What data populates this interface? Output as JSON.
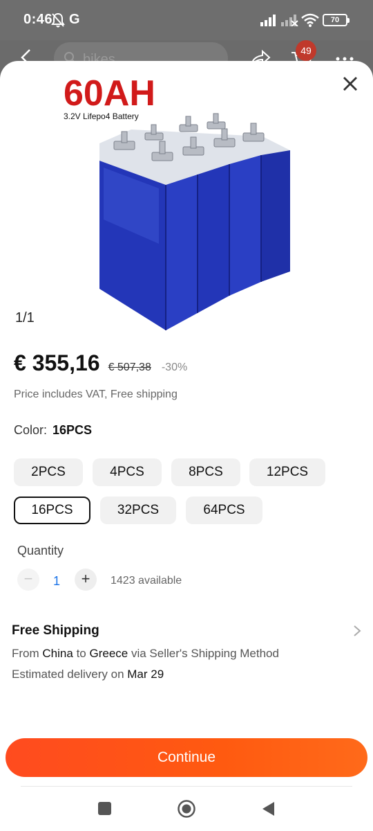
{
  "status_bar": {
    "time": "0:46",
    "carrier_letter": "G",
    "battery": "70"
  },
  "background_header": {
    "search_text": "bikes",
    "cart_badge": "49"
  },
  "product": {
    "image_brand": "60AH",
    "image_subtitle": "3.2V Lifepo4 Battery",
    "image_counter": "1/1",
    "price": "€ 355,16",
    "old_price": "€ 507,38",
    "discount": "-30%",
    "vat_note": "Price includes VAT, Free shipping"
  },
  "color": {
    "label": "Color:",
    "selected": "16PCS",
    "options": [
      "2PCS",
      "4PCS",
      "8PCS",
      "12PCS",
      "16PCS",
      "32PCS",
      "64PCS"
    ]
  },
  "quantity": {
    "label": "Quantity",
    "minus": "−",
    "value": "1",
    "plus": "+",
    "available": "1423 available"
  },
  "shipping": {
    "title": "Free Shipping",
    "from_prefix": "From",
    "origin": "China",
    "to_word": "to",
    "destination": "Greece",
    "via_text": "via Seller's Shipping Method",
    "delivery_prefix": "Estimated delivery on",
    "delivery_date": "Mar 29"
  },
  "actions": {
    "continue_label": "Continue"
  },
  "colors": {
    "accent": "#ff4b1f",
    "battery_blue": "#2a3fc4",
    "brand_red": "#d11a1a",
    "qty_blue": "#1a73e8"
  }
}
